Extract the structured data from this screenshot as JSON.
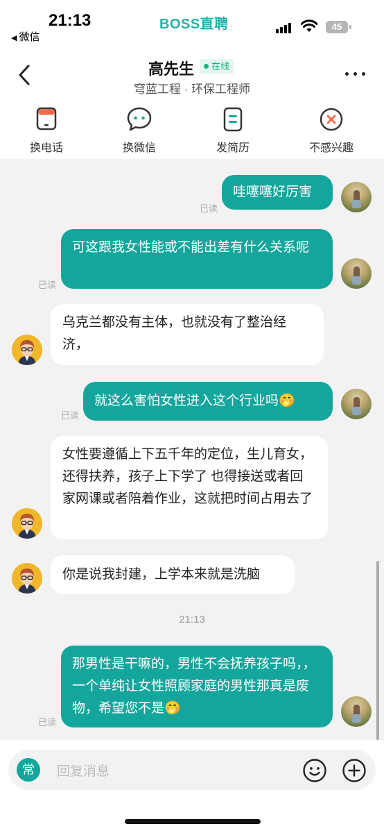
{
  "status": {
    "time": "21:13",
    "back_app": "微信",
    "brand": "BOSS直聘",
    "battery": "45"
  },
  "header": {
    "name": "高先生",
    "online": "在线",
    "subtitle": "穹蓝工程 · 环保工程师"
  },
  "actions": [
    {
      "label": "换电话",
      "icon": "phone-icon"
    },
    {
      "label": "换微信",
      "icon": "wechat-icon"
    },
    {
      "label": "发简历",
      "icon": "resume-icon"
    },
    {
      "label": "不感兴趣",
      "icon": "not-interested-icon"
    }
  ],
  "messages": [
    {
      "side": "out",
      "text": "哇噻噻好厉害",
      "read": "已读"
    },
    {
      "side": "out",
      "text": "可这跟我女性能或不能出差有什么关系呢",
      "read": "已读"
    },
    {
      "side": "in",
      "text": "乌克兰都没有主体，也就没有了整治经济，"
    },
    {
      "side": "out",
      "text": "就这么害怕女性进入这个行业吗",
      "emoji": "🤭",
      "read": "已读"
    },
    {
      "side": "in",
      "text": "女性要遵循上下五千年的定位，生儿育女，还得扶养，孩子上下学了 也得接送或者回家网课或者陪着作业，这就把时间占用去了"
    },
    {
      "side": "in",
      "text": "你是说我封建，上学本来就是洗脑"
    },
    {
      "side": "out",
      "text": "那男性是干嘛的，男性不会抚养孩子吗，，一个单纯让女性照顾家庭的男性那真是废物，希望您不是",
      "emoji": "🤭",
      "read": "已读"
    }
  ],
  "timestamp": "21:13",
  "input": {
    "quick": "常",
    "placeholder": "回复消息"
  },
  "colors": {
    "accent": "#14a69c",
    "brand": "#21b3a9",
    "online": "#18b27e"
  }
}
